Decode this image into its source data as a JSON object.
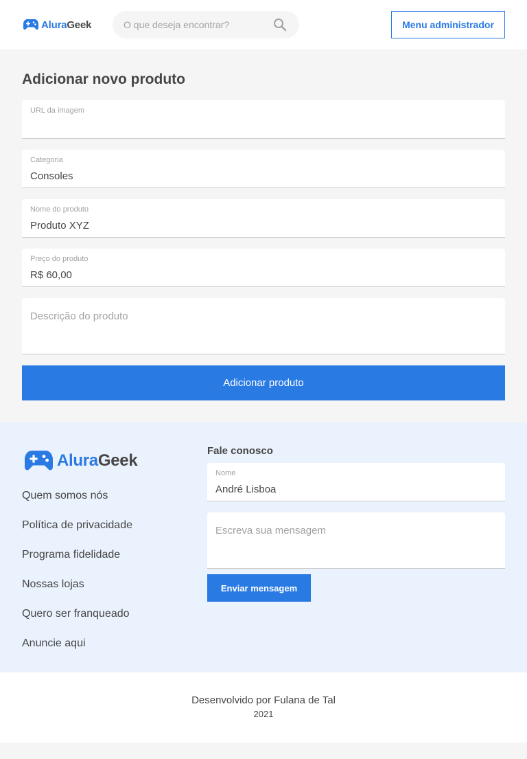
{
  "header": {
    "logo": {
      "alura": "Alura",
      "geek": "Geek"
    },
    "search_placeholder": "O que deseja encontrar?",
    "admin_button": "Menu administrador"
  },
  "form": {
    "title": "Adicionar novo produto",
    "fields": [
      {
        "label": "URL da imagem",
        "value": ""
      },
      {
        "label": "Categoria",
        "value": "Consoles"
      },
      {
        "label": "Nome do produto",
        "value": "Produto XYZ"
      },
      {
        "label": "Preço do produto",
        "value": "R$ 60,00"
      }
    ],
    "description_placeholder": "Descrição do produto",
    "submit": "Adicionar produto"
  },
  "footer": {
    "logo": {
      "alura": "Alura",
      "geek": "Geek"
    },
    "links": [
      "Quem somos nós",
      "Política de privacidade",
      "Programa fidelidade",
      "Nossas lojas",
      "Quero ser franqueado",
      "Anuncie aqui"
    ],
    "contact": {
      "title": "Fale conosco",
      "name_label": "Nome",
      "name_value": "André Lisboa",
      "message_placeholder": "Escreva sua mensagem",
      "send": "Enviar mensagem"
    }
  },
  "credits": {
    "developed_by": "Desenvolvido por Fulana de Tal",
    "year": "2021"
  },
  "colors": {
    "accent": "#2a7ae4",
    "text": "#464646",
    "background": "#f5f5f5",
    "footer_background": "#eaf2fd"
  }
}
